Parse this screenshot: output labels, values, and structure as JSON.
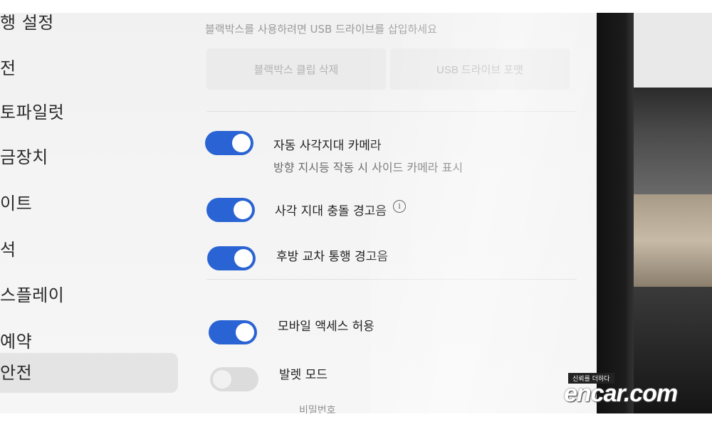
{
  "sidebar": {
    "items": [
      {
        "label": "행 설정"
      },
      {
        "label": "전"
      },
      {
        "label": "토파일럿"
      },
      {
        "label": "금장치"
      },
      {
        "label": "이트"
      },
      {
        "label": "석"
      },
      {
        "label": "스플레이"
      },
      {
        "label": "예약"
      },
      {
        "label": "안전"
      }
    ],
    "active_index": 8
  },
  "dashcam": {
    "usb_hint": "블랙박스를 사용하려면 USB 드라이브를 삽입하세요",
    "delete_clips_label": "블랙박스 클립 삭제",
    "format_usb_label": "USB 드라이브 포맷"
  },
  "settings": {
    "blind_spot_camera": {
      "label": "자동 사각지대 카메라",
      "sublabel": "방향 지시등 작동 시 사이드 카메라 표시",
      "enabled": true
    },
    "blind_spot_chime": {
      "label": "사각 지대 충돌 경고음",
      "info_icon": "info-icon",
      "enabled": true
    },
    "rear_cross_traffic": {
      "label": "후방 교차 통행 경고음",
      "enabled": true
    },
    "mobile_access": {
      "label": "모바일 액세스 허용",
      "enabled": true
    },
    "valet_mode": {
      "label": "발렛 모드",
      "enabled": false
    },
    "cut_off_text": "비밀번호"
  },
  "watermark": {
    "tagline": "신뢰를 더하다",
    "logo": "encar.com"
  },
  "colors": {
    "toggle_on": "#2a63d3",
    "toggle_off": "#dcdcdc",
    "background": "#f3f3f3"
  }
}
